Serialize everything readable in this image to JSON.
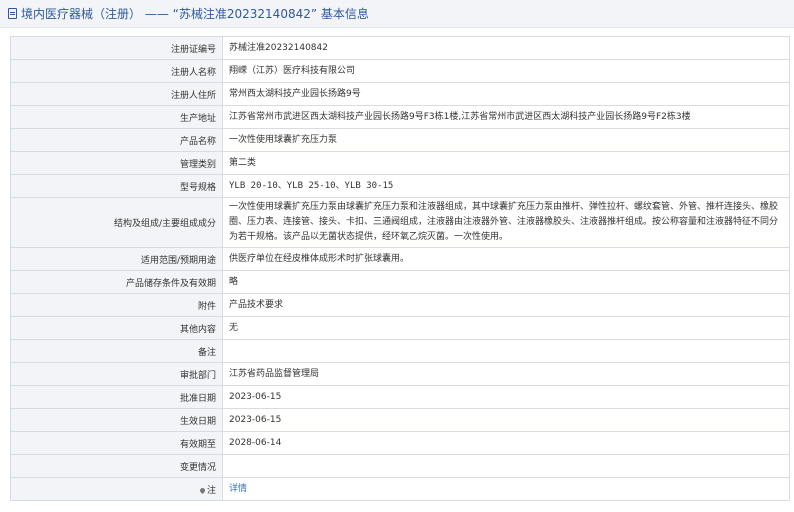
{
  "header": {
    "section": "境内医疗器械（注册）",
    "separator": " —— ",
    "record_title": "“苏械注准20232140842”",
    "suffix": " 基本信息"
  },
  "rows": [
    {
      "label": "注册证编号",
      "value": "苏械注准20232140842"
    },
    {
      "label": "注册人名称",
      "value": "翔嵘（江苏）医疗科技有限公司"
    },
    {
      "label": "注册人住所",
      "value": "常州西太湖科技产业园长扬路9号"
    },
    {
      "label": "生产地址",
      "value": "江苏省常州市武进区西太湖科技产业园长扬路9号F3栋1楼,江苏省常州市武进区西太湖科技产业园长扬路9号F2栋3楼"
    },
    {
      "label": "产品名称",
      "value": "一次性使用球囊扩充压力泵"
    },
    {
      "label": "管理类别",
      "value": "第二类"
    },
    {
      "label": "型号规格",
      "value": "YLB 20-10、YLB 25-10、YLB 30-15"
    },
    {
      "label": "结构及组成/主要组成成分",
      "value": "一次性使用球囊扩充压力泵由球囊扩充压力泵和注液器组成，其中球囊扩充压力泵由推杆、弹性拉杆、螺纹套管、外管、推杆连接头、橡胶圈、压力表、连接管、接头、卡扣、三通阀组成，注液器由注液器外管、注液器橡胶头、注液器推杆组成。按公称容量和注液器特征不同分为若干规格。该产品以无菌状态提供，经环氧乙烷灭菌。一次性使用。"
    },
    {
      "label": "适用范围/预期用途",
      "value": "供医疗单位在经皮椎体成形术时扩张球囊用。"
    },
    {
      "label": "产品储存条件及有效期",
      "value": "略"
    },
    {
      "label": "附件",
      "value": "产品技术要求"
    },
    {
      "label": "其他内容",
      "value": "无"
    },
    {
      "label": "备注",
      "value": ""
    },
    {
      "label": "审批部门",
      "value": "江苏省药品监督管理局"
    },
    {
      "label": "批准日期",
      "value": "2023-06-15"
    },
    {
      "label": "生效日期",
      "value": "2023-06-15"
    },
    {
      "label": "有效期至",
      "value": "2028-06-14"
    },
    {
      "label": "变更情况",
      "value": ""
    },
    {
      "label": "注",
      "value": "详情"
    }
  ],
  "icons": {
    "header": "document-icon",
    "note": "pin-icon"
  },
  "colors": {
    "accent": "#2d5a9e",
    "link": "#2d6fc4",
    "label_bg": "#f3f4f7",
    "border": "#d7dbe2"
  }
}
